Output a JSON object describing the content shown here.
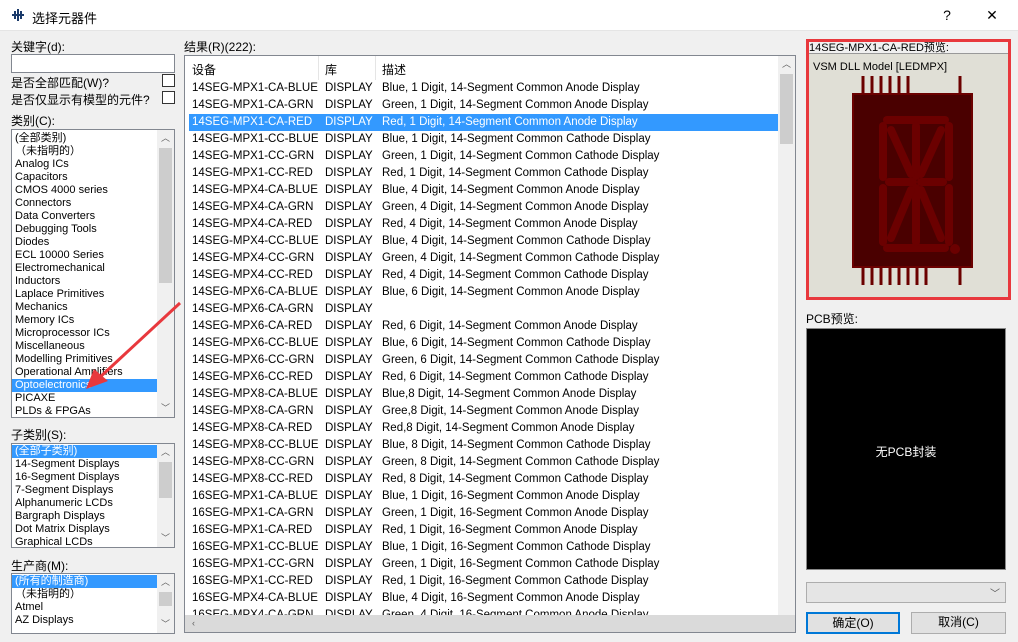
{
  "window": {
    "title": "选择元器件",
    "help": "?",
    "close": "✕"
  },
  "left": {
    "keyword_label": "关键字(d):",
    "keyword_value": "",
    "match_all_label": "是否全部匹配(W)?",
    "match_all_checked": false,
    "model_only_label": "是否仅显示有模型的元件?",
    "model_only_checked": false,
    "category_label": "类别(C):",
    "categories": [
      "(全部类别)",
      "（未指明的）",
      "Analog ICs",
      "Capacitors",
      "CMOS 4000 series",
      "Connectors",
      "Data Converters",
      "Debugging Tools",
      "Diodes",
      "ECL 10000 Series",
      "Electromechanical",
      "Inductors",
      "Laplace Primitives",
      "Mechanics",
      "Memory ICs",
      "Microprocessor ICs",
      "Miscellaneous",
      "Modelling Primitives",
      "Operational Amplifiers",
      "Optoelectronics",
      "PICAXE",
      "PLDs & FPGAs"
    ],
    "category_selected": "Optoelectronics",
    "subcategory_label": "子类别(S):",
    "subcategories": [
      "(全部子类别)",
      "14-Segment Displays",
      "16-Segment Displays",
      "7-Segment Displays",
      "Alphanumeric LCDs",
      "Bargraph Displays",
      "Dot Matrix Displays",
      "Graphical LCDs"
    ],
    "subcategory_selected": "(全部子类别)",
    "manufacturer_label": "生产商(M):",
    "manufacturers": [
      "(所有的制造商)",
      "（未指明的）",
      "Atmel",
      "AZ Displays"
    ],
    "manufacturer_selected": "(所有的制造商)"
  },
  "results": {
    "label": "结果(R)(222):",
    "columns": [
      "设备",
      "库",
      "描述"
    ],
    "selected": "14SEG-MPX1-CA-RED",
    "rows": [
      [
        "14SEG-MPX1-CA-BLUE",
        "DISPLAY",
        "Blue, 1 Digit, 14-Segment Common Anode Display"
      ],
      [
        "14SEG-MPX1-CA-GRN",
        "DISPLAY",
        "Green, 1 Digit, 14-Segment Common Anode Display"
      ],
      [
        "14SEG-MPX1-CA-RED",
        "DISPLAY",
        "Red, 1 Digit, 14-Segment Common Anode Display"
      ],
      [
        "14SEG-MPX1-CC-BLUE",
        "DISPLAY",
        "Blue, 1 Digit, 14-Segment Common Cathode Display"
      ],
      [
        "14SEG-MPX1-CC-GRN",
        "DISPLAY",
        "Green, 1 Digit, 14-Segment Common Cathode Display"
      ],
      [
        "14SEG-MPX1-CC-RED",
        "DISPLAY",
        "Red, 1 Digit, 14-Segment Common Cathode Display"
      ],
      [
        "14SEG-MPX4-CA-BLUE",
        "DISPLAY",
        "Blue, 4 Digit, 14-Segment Common Anode Display"
      ],
      [
        "14SEG-MPX4-CA-GRN",
        "DISPLAY",
        "Green, 4 Digit, 14-Segment Common Anode Display"
      ],
      [
        "14SEG-MPX4-CA-RED",
        "DISPLAY",
        "Red, 4 Digit, 14-Segment Common Anode Display"
      ],
      [
        "14SEG-MPX4-CC-BLUE",
        "DISPLAY",
        "Blue, 4 Digit, 14-Segment Common Cathode Display"
      ],
      [
        "14SEG-MPX4-CC-GRN",
        "DISPLAY",
        "Green, 4 Digit, 14-Segment Common Cathode Display"
      ],
      [
        "14SEG-MPX4-CC-RED",
        "DISPLAY",
        "Red, 4 Digit, 14-Segment Common Cathode Display"
      ],
      [
        "14SEG-MPX6-CA-BLUE",
        "DISPLAY",
        "Blue, 6 Digit, 14-Segment Common Anode Display"
      ],
      [
        "14SEG-MPX6-CA-GRN",
        "DISPLAY",
        ""
      ],
      [
        "14SEG-MPX6-CA-RED",
        "DISPLAY",
        "Red, 6 Digit, 14-Segment Common Anode Display"
      ],
      [
        "14SEG-MPX6-CC-BLUE",
        "DISPLAY",
        "Blue, 6 Digit, 14-Segment Common Cathode Display"
      ],
      [
        "14SEG-MPX6-CC-GRN",
        "DISPLAY",
        "Green, 6 Digit, 14-Segment Common Cathode Display"
      ],
      [
        "14SEG-MPX6-CC-RED",
        "DISPLAY",
        "Red, 6 Digit, 14-Segment Common Cathode Display"
      ],
      [
        "14SEG-MPX8-CA-BLUE",
        "DISPLAY",
        "Blue,8 Digit, 14-Segment Common Anode Display"
      ],
      [
        "14SEG-MPX8-CA-GRN",
        "DISPLAY",
        "Gree,8 Digit, 14-Segment Common Anode Display"
      ],
      [
        "14SEG-MPX8-CA-RED",
        "DISPLAY",
        "Red,8 Digit, 14-Segment Common Anode Display"
      ],
      [
        "14SEG-MPX8-CC-BLUE",
        "DISPLAY",
        "Blue, 8 Digit, 14-Segment Common Cathode Display"
      ],
      [
        "14SEG-MPX8-CC-GRN",
        "DISPLAY",
        "Green, 8 Digit, 14-Segment Common Cathode Display"
      ],
      [
        "14SEG-MPX8-CC-RED",
        "DISPLAY",
        "Red, 8 Digit, 14-Segment Common Cathode Display"
      ],
      [
        "16SEG-MPX1-CA-BLUE",
        "DISPLAY",
        "Blue, 1 Digit, 16-Segment Common Anode Display"
      ],
      [
        "16SEG-MPX1-CA-GRN",
        "DISPLAY",
        "Green, 1 Digit, 16-Segment Common Anode Display"
      ],
      [
        "16SEG-MPX1-CA-RED",
        "DISPLAY",
        "Red, 1 Digit, 16-Segment Common Anode Display"
      ],
      [
        "16SEG-MPX1-CC-BLUE",
        "DISPLAY",
        "Blue, 1 Digit, 16-Segment Common Cathode Display"
      ],
      [
        "16SEG-MPX1-CC-GRN",
        "DISPLAY",
        "Green, 1 Digit, 16-Segment Common Cathode Display"
      ],
      [
        "16SEG-MPX1-CC-RED",
        "DISPLAY",
        "Red, 1 Digit, 16-Segment Common Cathode Display"
      ],
      [
        "16SEG-MPX4-CA-BLUE",
        "DISPLAY",
        "Blue, 4 Digit, 16-Segment Common Anode Display"
      ],
      [
        "16SEG-MPX4-CA-GRN",
        "DISPLAY",
        "Green, 4 Digit, 16-Segment Common Anode Display"
      ]
    ]
  },
  "preview": {
    "title": "14SEG-MPX1-CA-RED预览:",
    "model_text": "VSM DLL Model [LEDMPX]",
    "border_color": "#e8383d"
  },
  "pcb": {
    "label": "PCB预览:",
    "empty_text": "无PCB封装"
  },
  "footer": {
    "dropdown_value": "",
    "ok_label": "确定(O)",
    "cancel_label": "取消(C)"
  },
  "colors": {
    "selection": "#3399ff",
    "segment_body": "#4a0000",
    "segment": "#6b0000"
  }
}
